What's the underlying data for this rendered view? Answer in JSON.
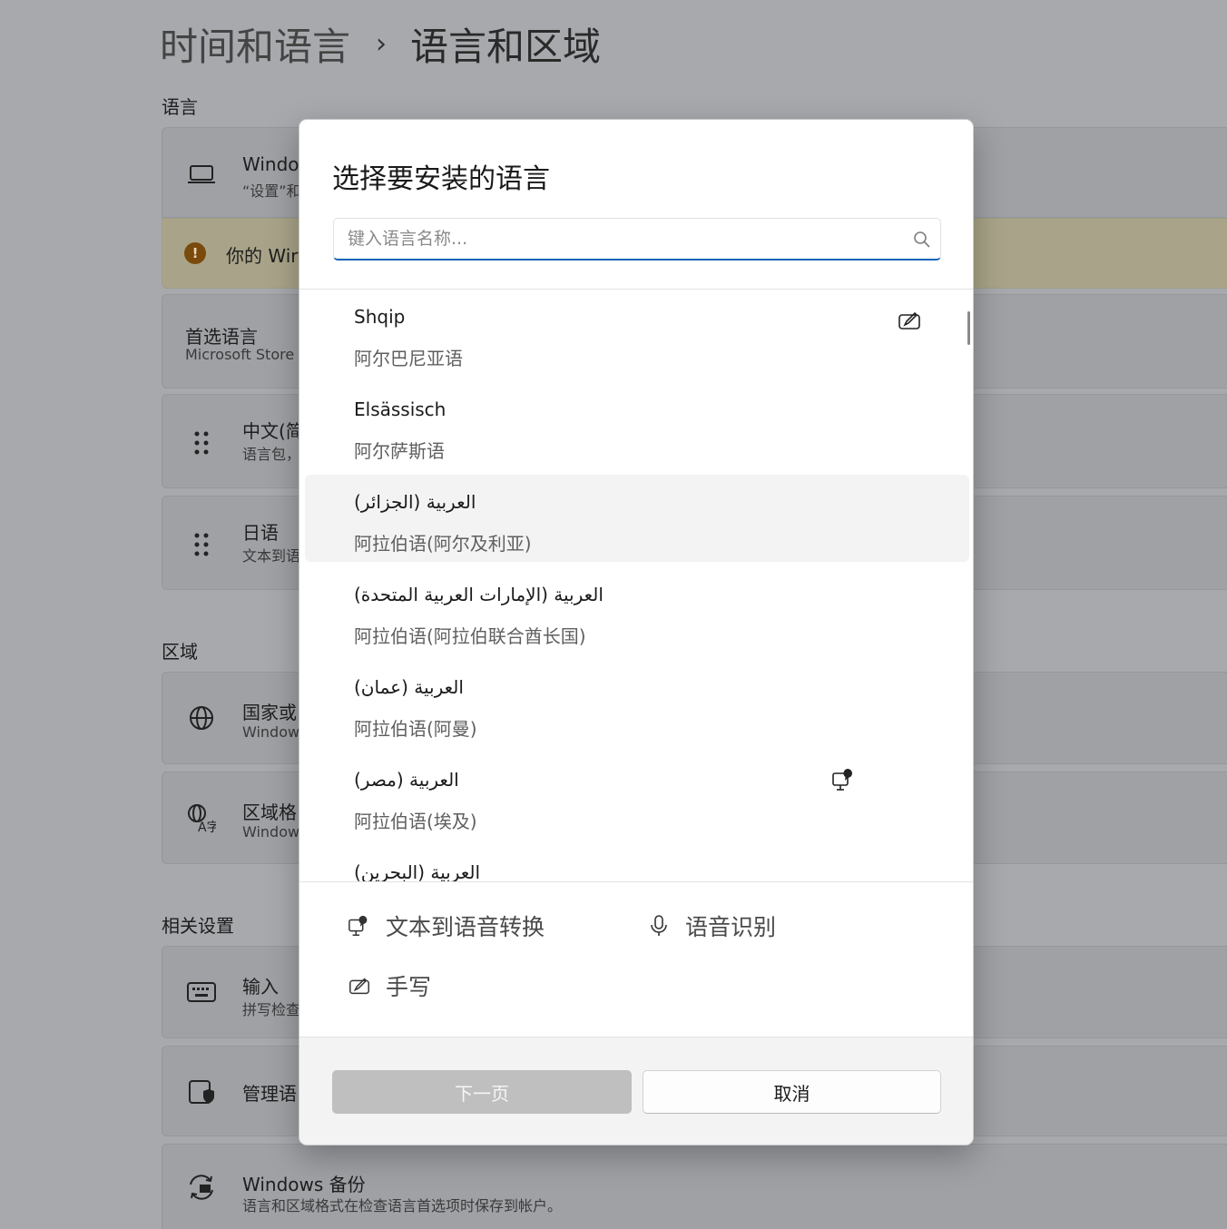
{
  "breadcrumb": {
    "parent": "时间和语言",
    "separator": "›",
    "current": "语言和区域"
  },
  "sections": {
    "language": "语言",
    "region": "区域",
    "related": "相关设置"
  },
  "bg_cards": {
    "windows_display": {
      "title": "Windo",
      "subtitle": "“设置”和",
      "icon": "laptop-icon"
    },
    "warning": {
      "text": "你的 Wir",
      "icon": "warning-icon"
    },
    "preferred": {
      "title": "首选语言",
      "subtitle": "Microsoft Store"
    },
    "lang_zh": {
      "title": "中文(简",
      "subtitle": "语言包，",
      "icon": "drag-handle-icon"
    },
    "lang_ja": {
      "title": "日语",
      "subtitle": "文本到语",
      "icon": "drag-handle-icon"
    },
    "country": {
      "title": "国家或",
      "subtitle": "Window",
      "icon": "globe-icon"
    },
    "regional_format": {
      "title": "区域格",
      "subtitle": "Window",
      "icon": "language-format-icon"
    },
    "input": {
      "title": "输入",
      "subtitle": "拼写检查",
      "icon": "keyboard-icon"
    },
    "admin_lang": {
      "title": "管理语",
      "icon": "admin-shield-icon"
    },
    "backup": {
      "title": "Windows 备份",
      "subtitle": "语言和区域格式在检查语言首选项时保存到帐户。",
      "icon": "backup-sync-icon"
    }
  },
  "dialog": {
    "title": "选择要安装的语言",
    "search": {
      "value": "",
      "placeholder": "键入语言名称..."
    },
    "languages": [
      {
        "native": "Shqip",
        "local": "阿尔巴尼亚语",
        "features": [
          "handwriting-icon"
        ]
      },
      {
        "native": "Elsässisch",
        "local": "阿尔萨斯语",
        "features": []
      },
      {
        "native": "العربية (الجزائر)",
        "local": "阿拉伯语(阿尔及利亚)",
        "features": [],
        "hover": true
      },
      {
        "native": "العربية (الإمارات العربية المتحدة)",
        "local": "阿拉伯语(阿拉伯联合酋长国)",
        "features": []
      },
      {
        "native": "العربية (عمان)",
        "local": "阿拉伯语(阿曼)",
        "features": []
      },
      {
        "native": "العربية (مصر)",
        "local": "阿拉伯语(埃及)",
        "features": [
          "text-to-speech-icon"
        ]
      },
      {
        "native": "العربية (البحرين)",
        "local": "",
        "features": []
      }
    ],
    "legend": {
      "tts": "文本到语音转换",
      "speech": "语音识别",
      "handwriting": "手写"
    },
    "buttons": {
      "next": "下一页",
      "cancel": "取消"
    }
  }
}
